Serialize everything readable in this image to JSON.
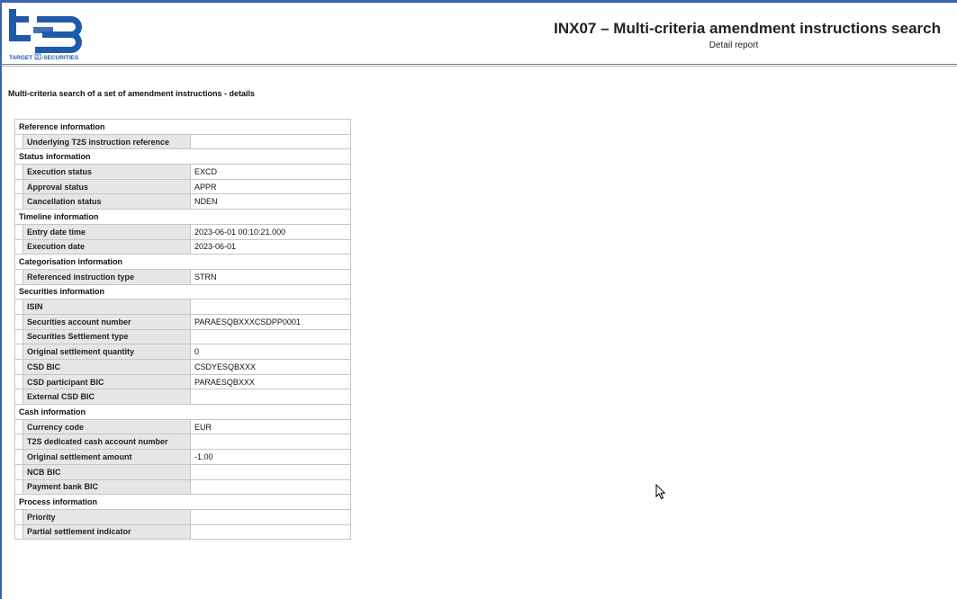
{
  "logo": {
    "tagline_left": "TARGET",
    "tagline_right": "-SECURITIES"
  },
  "header": {
    "title": "INX07 – Multi-criteria amendment instructions search",
    "subtitle": "Detail report"
  },
  "page": {
    "section_title": "Multi-criteria search of a set of amendment instructions - details"
  },
  "groups": [
    {
      "title": "Reference information",
      "rows": [
        {
          "label": "Underlying T2S instruction reference",
          "value": ""
        }
      ]
    },
    {
      "title": "Status information",
      "rows": [
        {
          "label": "Execution status",
          "value": "EXCD"
        },
        {
          "label": "Approval status",
          "value": "APPR"
        },
        {
          "label": "Cancellation status",
          "value": "NDEN"
        }
      ]
    },
    {
      "title": "Timeline information",
      "rows": [
        {
          "label": "Entry date time",
          "value": "2023-06-01 00:10:21.000"
        },
        {
          "label": "Execution date",
          "value": "2023-06-01"
        }
      ]
    },
    {
      "title": "Categorisation information",
      "rows": [
        {
          "label": "Referenced instruction type",
          "value": "STRN"
        }
      ]
    },
    {
      "title": "Securities information",
      "rows": [
        {
          "label": "ISIN",
          "value": ""
        },
        {
          "label": "Securities account number",
          "value": "PARAESQBXXXCSDPP0001"
        },
        {
          "label": "Securities Settlement type",
          "value": ""
        },
        {
          "label": "Original settlement quantity",
          "value": "0"
        },
        {
          "label": "CSD BIC",
          "value": "CSDYESQBXXX"
        },
        {
          "label": "CSD participant BIC",
          "value": "PARAESQBXXX"
        },
        {
          "label": "External CSD BIC",
          "value": ""
        }
      ]
    },
    {
      "title": "Cash information",
      "rows": [
        {
          "label": "Currency code",
          "value": "EUR"
        },
        {
          "label": "T2S dedicated cash account number",
          "value": ""
        },
        {
          "label": "Original settlement amount",
          "value": "-1.00"
        },
        {
          "label": "NCB BIC",
          "value": ""
        },
        {
          "label": "Payment bank BIC",
          "value": ""
        }
      ]
    },
    {
      "title": "Process information",
      "rows": [
        {
          "label": "Priority",
          "value": ""
        },
        {
          "label": "Partial settlement indicator",
          "value": ""
        }
      ]
    }
  ],
  "colors": {
    "frame": "#3a63b3",
    "logo_blue": "#1f5aa8",
    "label_bg": "#e6e6e6",
    "border": "#c6c6c6"
  }
}
